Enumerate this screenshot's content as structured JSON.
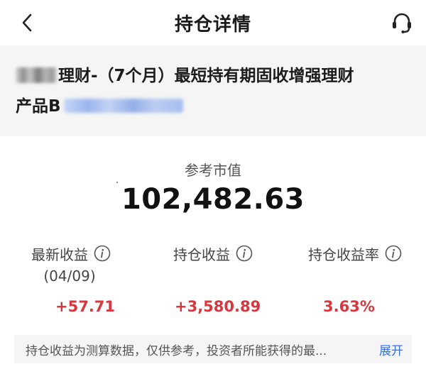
{
  "header": {
    "title": "持仓详情",
    "back_icon": "chevron-left-icon",
    "service_icon": "headset-icon"
  },
  "product": {
    "name_line1": "理财-（7个月）最短持有期固收增强理财",
    "name_line2": "产品B"
  },
  "market_value": {
    "label": "参考市值",
    "amount": "102,482.63"
  },
  "stats": {
    "latest_income": {
      "label": "最新收益",
      "date": "(04/09)",
      "value": "+57.71"
    },
    "holding_income": {
      "label": "持仓收益",
      "value": "+3,580.89"
    },
    "holding_rate": {
      "label": "持仓收益率",
      "value": "3.63%"
    }
  },
  "notice": {
    "text": "持仓收益为测算数据，仅供参考，投资者所能获得的最...",
    "expand_label": "展开"
  },
  "colors": {
    "positive": "#d9363e",
    "link": "#2f6ff0",
    "panel_bg": "#f5f5f5"
  }
}
